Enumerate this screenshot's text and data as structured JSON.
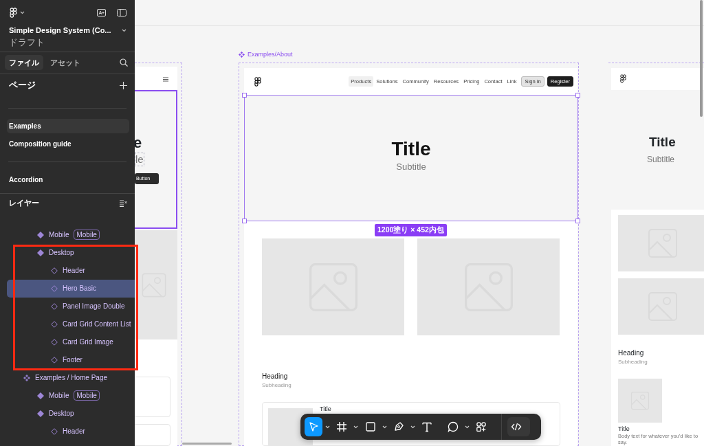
{
  "sidebar": {
    "file_title": "Simple Design System (Co...",
    "file_location": "ドラフト",
    "tabs": [
      {
        "label": "ファイル",
        "selected": true
      },
      {
        "label": "アセット",
        "selected": false
      }
    ],
    "pages_heading": "ページ",
    "pages": [
      {
        "kind": "page",
        "label": "Examples",
        "selected": true
      },
      {
        "kind": "page",
        "label": "Composition guide",
        "selected": false
      },
      {
        "kind": "divider"
      },
      {
        "kind": "page",
        "label": "Accordion",
        "selected": false
      }
    ],
    "layers_heading": "レイヤー",
    "layers": [
      {
        "children": [
          {
            "kind": "component",
            "label": "Mobile",
            "badge": "Mobile",
            "selected": false
          },
          {
            "kind": "component",
            "label": "Desktop",
            "selected": false,
            "children": [
              {
                "kind": "instance",
                "label": "Header",
                "selected": false
              },
              {
                "kind": "instance",
                "label": "Hero Basic",
                "selected": true
              },
              {
                "kind": "instance",
                "label": "Panel Image Double",
                "selected": false
              },
              {
                "kind": "instance",
                "label": "Card Grid Content List",
                "selected": false
              },
              {
                "kind": "instance",
                "label": "Card Grid Image",
                "selected": false
              },
              {
                "kind": "instance",
                "label": "Footer",
                "selected": false
              }
            ]
          }
        ]
      },
      {
        "kind": "component-set",
        "label": "Examples / Home Page",
        "selected": false,
        "children": [
          {
            "kind": "component",
            "label": "Mobile",
            "badge": "Mobile",
            "selected": false
          },
          {
            "kind": "component",
            "label": "Desktop",
            "selected": false,
            "children": [
              {
                "kind": "instance",
                "label": "Header",
                "selected": false
              }
            ]
          }
        ]
      }
    ]
  },
  "left_frame": {
    "title_fragment": "e",
    "subtitle_fragment": "le",
    "button": "Button"
  },
  "main_frame": {
    "label": "Examples/About",
    "nav": [
      {
        "label": "Products",
        "selected": true
      },
      {
        "label": "Solutions",
        "selected": false
      },
      {
        "label": "Community",
        "selected": false
      },
      {
        "label": "Resources",
        "selected": false
      },
      {
        "label": "Pricing",
        "selected": false
      },
      {
        "label": "Contact",
        "selected": false
      },
      {
        "label": "Link",
        "selected": false
      }
    ],
    "sign_in": "Sign in",
    "register": "Register",
    "title": "Title",
    "subtitle": "Subtitle",
    "size_badge": "1200塗り × 452内包",
    "heading": "Heading",
    "subheading": "Subheading",
    "card_title": "Title"
  },
  "right_frame": {
    "title": "Title",
    "subtitle": "Subtitle",
    "heading": "Heading",
    "subheading": "Subheading",
    "card_title": "Title",
    "card_body": "Body text for whatever you'd like to say."
  },
  "toolbar": {
    "tools": [
      {
        "kind": "move",
        "selected": true,
        "menu": true
      },
      {
        "kind": "frame",
        "selected": false,
        "menu": true
      },
      {
        "kind": "rectangle",
        "selected": false,
        "menu": true
      },
      {
        "kind": "pen",
        "selected": false,
        "menu": true
      },
      {
        "kind": "text",
        "selected": false,
        "menu": false
      },
      {
        "kind": "comment",
        "selected": false,
        "menu": true
      },
      {
        "kind": "actions",
        "selected": false,
        "menu": false
      },
      {
        "kind": "code",
        "selected": false,
        "menu": false
      }
    ]
  }
}
